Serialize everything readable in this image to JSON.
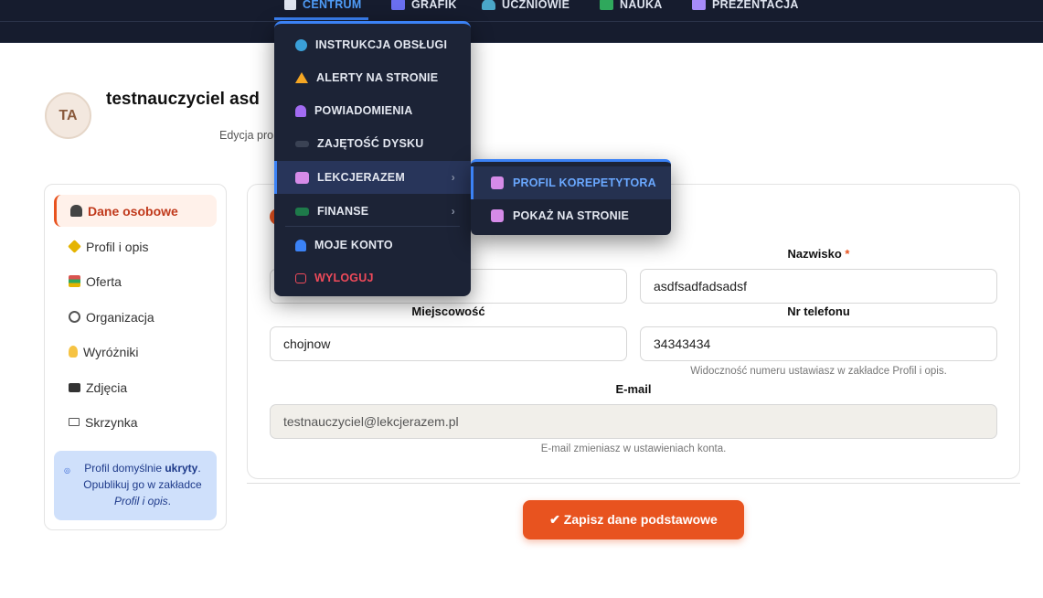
{
  "topnav": {
    "items": [
      {
        "label": "CENTRUM",
        "icon": "home-icon"
      },
      {
        "label": "GRAFIK",
        "icon": "calendar-icon"
      },
      {
        "label": "UCZNIOWIE",
        "icon": "users-icon"
      },
      {
        "label": "NAUKA",
        "icon": "book-icon"
      },
      {
        "label": "PREZENTACJA",
        "icon": "monitor-icon"
      }
    ]
  },
  "profile": {
    "initials": "TA",
    "name": "testnauczyciel asd",
    "subtitle": "Edycja pro"
  },
  "dropdown": {
    "items": [
      {
        "label": "INSTRUKCJA OBSŁUGI",
        "icon": "info-icon"
      },
      {
        "label": "ALERTY NA STRONIE",
        "icon": "warning-icon"
      },
      {
        "label": "POWIADOMIENIA",
        "icon": "bell-icon"
      },
      {
        "label": "ZAJĘTOŚĆ DYSKU",
        "icon": "disk-icon"
      },
      {
        "label": "LEKCJERAZEM",
        "icon": "profile-card-icon"
      },
      {
        "label": "FINANSE",
        "icon": "money-icon"
      },
      {
        "label": "MOJE KONTO",
        "icon": "user-icon"
      },
      {
        "label": "WYLOGUJ",
        "icon": "logout-icon"
      }
    ],
    "chevron": "›"
  },
  "submenu": {
    "items": [
      {
        "label": "PROFIL KOREPETYTORA",
        "icon": "profile-card-icon"
      },
      {
        "label": "POKAŻ NA STRONIE",
        "icon": "profile-card-icon"
      }
    ]
  },
  "sidebar": {
    "items": [
      {
        "label": "Dane osobowe",
        "icon": "person-icon"
      },
      {
        "label": "Profil i opis",
        "icon": "sparkle-icon"
      },
      {
        "label": "Oferta",
        "icon": "books-icon"
      },
      {
        "label": "Organizacja",
        "icon": "gear-icon"
      },
      {
        "label": "Wyróżniki",
        "icon": "lightbulb-icon"
      },
      {
        "label": "Zdjęcia",
        "icon": "camera-icon"
      },
      {
        "label": "Skrzynka",
        "icon": "envelope-icon"
      }
    ],
    "info": {
      "prefix": "Profil domyślnie ",
      "strong": "ukryty",
      "middle": ". Opublikuj go w zakładce ",
      "link": "Profil i opis",
      "suffix": "."
    }
  },
  "form": {
    "nazwisko_label": "Nazwisko",
    "required_mark": "*",
    "nazwisko_value": "asdfsadfadsadsf",
    "miejscowosc_label": "Miejscowość",
    "miejscowosc_value": "chojnow",
    "telefon_label": "Nr telefonu",
    "telefon_value": "34343434",
    "telefon_hint": "Widoczność numeru ustawiasz w zakładce Profil i opis.",
    "email_label": "E-mail",
    "email_value": "testnauczyciel@lekcjerazem.pl",
    "email_hint": "E-mail zmieniasz w ustawieniach konta."
  },
  "save_button": "✔ Zapisz dane podstawowe",
  "colors": {
    "accent": "#e8531f",
    "nav_bg": "#161c2e",
    "menu_bg": "#1c2336",
    "menu_highlight": "#3b82f6"
  }
}
